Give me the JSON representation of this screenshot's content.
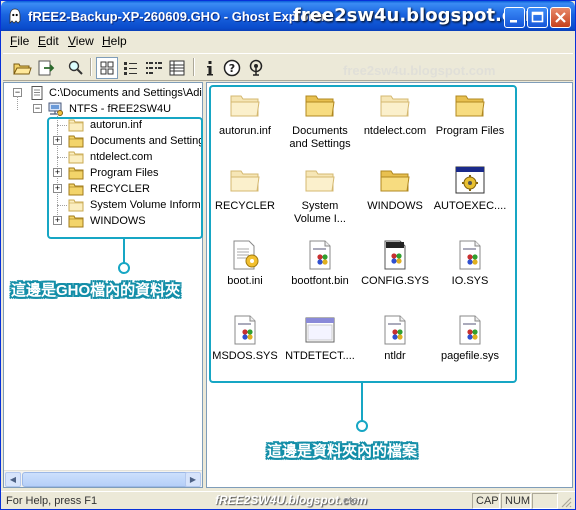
{
  "window": {
    "title": "fREE2-Backup-XP-260609.GHO - Ghost Explorer",
    "watermark": "free2sw4u.blogspot.com",
    "watermark_faint": "free2sw4u.blogspot.com"
  },
  "menu": [
    {
      "label_u": "F",
      "label_rest": "ile"
    },
    {
      "label_u": "E",
      "label_rest": "dit"
    },
    {
      "label_u": "V",
      "label_rest": "iew"
    },
    {
      "label_u": "H",
      "label_rest": "elp"
    }
  ],
  "tree": {
    "root_path": "C:\\Documents and Settings\\Adi",
    "volume_label": "NTFS - fREE2SW4U",
    "items": [
      {
        "label": "autorun.inf",
        "expandable": false
      },
      {
        "label": "Documents and Setting",
        "expandable": true
      },
      {
        "label": "ntdelect.com",
        "expandable": false
      },
      {
        "label": "Program Files",
        "expandable": true
      },
      {
        "label": "RECYCLER",
        "expandable": true
      },
      {
        "label": "System Volume Informa",
        "expandable": false
      },
      {
        "label": "WINDOWS",
        "expandable": true
      }
    ]
  },
  "files": [
    {
      "label": "autorun.inf",
      "icon": "folder-pale"
    },
    {
      "label": "Documents and Settings",
      "icon": "folder"
    },
    {
      "label": "ntdelect.com",
      "icon": "folder-pale"
    },
    {
      "label": "Program Files",
      "icon": "folder"
    },
    {
      "label": "RECYCLER",
      "icon": "folder-pale"
    },
    {
      "label": "System Volume I...",
      "icon": "folder-pale"
    },
    {
      "label": "WINDOWS",
      "icon": "folder"
    },
    {
      "label": "AUTOEXEC....",
      "icon": "batch-file"
    },
    {
      "label": "boot.ini",
      "icon": "ini-file"
    },
    {
      "label": "bootfont.bin",
      "icon": "system-file"
    },
    {
      "label": "CONFIG.SYS",
      "icon": "config-file"
    },
    {
      "label": "IO.SYS",
      "icon": "system-file"
    },
    {
      "label": "MSDOS.SYS",
      "icon": "system-file"
    },
    {
      "label": "NTDETECT....",
      "icon": "app-window"
    },
    {
      "label": "ntldr",
      "icon": "system-file"
    },
    {
      "label": "pagefile.sys",
      "icon": "system-file"
    }
  ],
  "annotations": {
    "tree_caption": "這邊是GHO檔內的資料夾",
    "list_caption": "這邊是資料夾內的檔案",
    "accent_color": "#16a6c4"
  },
  "status": {
    "help_text": "For Help, press F1",
    "watermark": "fREE2SW4U.blogspot.com",
    "faint_text": "ete",
    "cap": "CAP",
    "num": "NUM"
  }
}
